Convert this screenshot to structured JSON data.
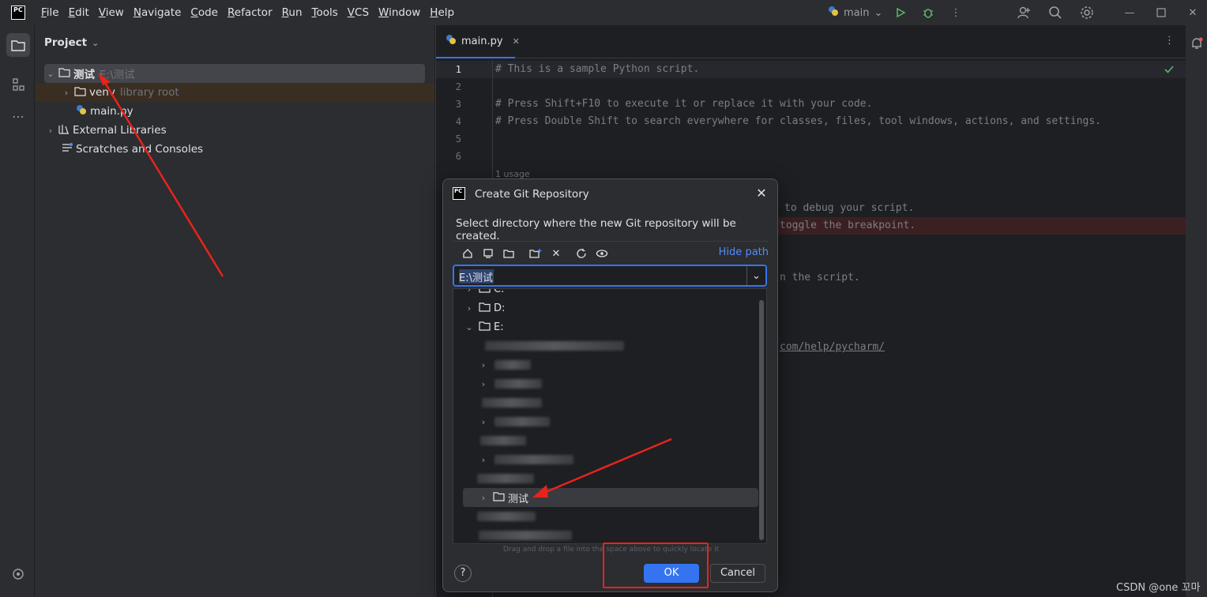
{
  "menu": [
    "File",
    "Edit",
    "View",
    "Navigate",
    "Code",
    "Refactor",
    "Run",
    "Tools",
    "VCS",
    "Window",
    "Help"
  ],
  "app_logo": "PC",
  "branch": "main",
  "project": {
    "header": "Project",
    "tree": [
      {
        "label": "测试",
        "suffix": "E:\\测试"
      },
      {
        "label": "venv",
        "suffix": "library root"
      },
      {
        "label": "main.py",
        "suffix": ""
      },
      {
        "label": "External Libraries",
        "suffix": ""
      },
      {
        "label": "Scratches and Consoles",
        "suffix": ""
      }
    ]
  },
  "editor": {
    "tab": "main.py",
    "line_numbers": [
      "1",
      "2",
      "3",
      "4",
      "5",
      "6"
    ],
    "code": [
      "# This is a sample Python script.",
      "",
      "# Press Shift+F10 to execute it or replace it with your code.",
      "# Press Double Shift to search everywhere for classes, files, tool windows, actions, and settings.",
      "",
      ""
    ],
    "usage_hint": "1 usage",
    "partial_lines": [
      "to debug your script.",
      "toggle the breakpoint.",
      "n the script.",
      "com/help/pycharm/"
    ]
  },
  "dialog": {
    "title": "Create Git Repository",
    "description": "Select directory where the new Git repository will be created.",
    "hide_path": "Hide path",
    "path_value": "E:\\测试",
    "tree": [
      {
        "label": "C:"
      },
      {
        "label": "D:"
      },
      {
        "label": "E:"
      },
      {
        "label": "测试"
      }
    ],
    "drag_hint": "Drag and drop a file into the space above to quickly locate it",
    "help": "?",
    "ok": "OK",
    "cancel": "Cancel"
  },
  "watermark": "CSDN @one 꼬마",
  "colors": {
    "accent": "#3574f0",
    "annotation_red": "#e8231d"
  }
}
